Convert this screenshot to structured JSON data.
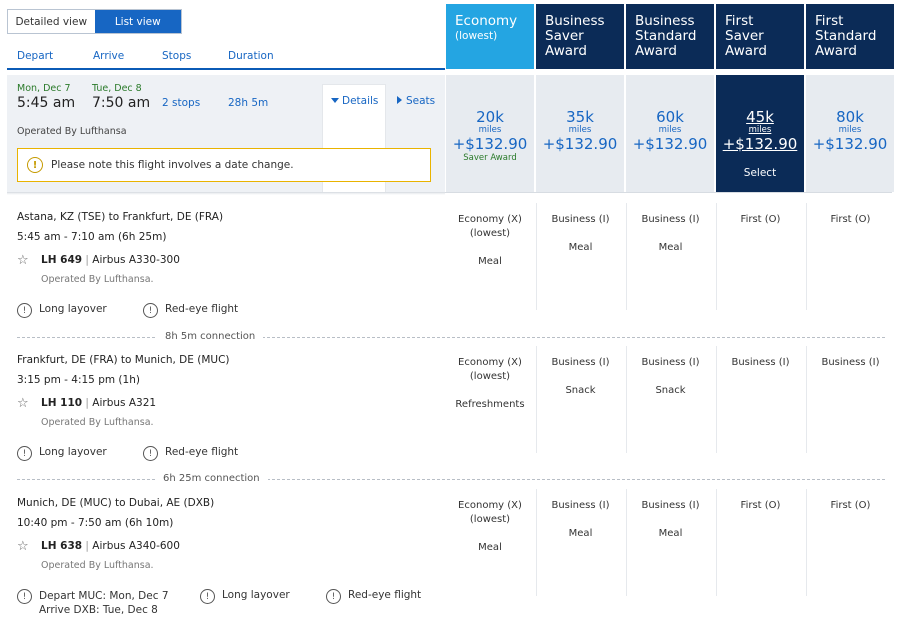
{
  "view_toggle": {
    "detailed": "Detailed view",
    "list": "List view"
  },
  "sort": {
    "depart": "Depart",
    "arrive": "Arrive",
    "stops": "Stops",
    "duration": "Duration"
  },
  "fare_headers": [
    {
      "line1": "Economy",
      "line2": "(lowest)",
      "color": "#24a5e2"
    },
    {
      "line1": "Business",
      "line2": "Saver",
      "line3": "Award",
      "color": "#0b2b57"
    },
    {
      "line1": "Business",
      "line2": "Standard",
      "line3": "Award",
      "color": "#0b2b57"
    },
    {
      "line1": "First Saver",
      "line2": "Award",
      "color": "#0b2b57"
    },
    {
      "line1": "First",
      "line2": "Standard",
      "line3": "Award",
      "color": "#0b2b57"
    }
  ],
  "summary": {
    "depart_date": "Mon, Dec 7",
    "depart_time": "5:45 am",
    "arrive_date": "Tue, Dec 8",
    "arrive_time": "7:50 am",
    "stops": "2 stops",
    "duration": "28h 5m",
    "details": "Details",
    "seats": "Seats",
    "operated": "Operated By Lufthansa",
    "notice": "Please note this flight involves a date change."
  },
  "prices": [
    {
      "miles": "20k",
      "mlabel": "miles",
      "money": "+$132.90",
      "saver": "Saver Award"
    },
    {
      "miles": "35k",
      "mlabel": "miles",
      "money": "+$132.90"
    },
    {
      "miles": "60k",
      "mlabel": "miles",
      "money": "+$132.90"
    },
    {
      "miles": "45k",
      "mlabel": "miles",
      "money": "+$132.90",
      "select": "Select"
    },
    {
      "miles": "80k",
      "mlabel": "miles",
      "money": "+$132.90"
    }
  ],
  "segments": [
    {
      "route": "Astana, KZ (TSE) to Frankfurt, DE (FRA)",
      "time": "5:45 am - 7:10 am (6h 25m)",
      "flight_no": "LH 649",
      "aircraft": "Airbus A330-300",
      "separator": "|",
      "operated": "Operated By Lufthansa.",
      "notes": [
        "Long layover",
        "Red-eye flight"
      ],
      "fares": [
        {
          "cabin": "Economy (X)",
          "extra": "(lowest)",
          "meal": "Meal"
        },
        {
          "cabin": "Business (I)",
          "meal": "Meal"
        },
        {
          "cabin": "Business (I)",
          "meal": "Meal"
        },
        {
          "cabin": "First (O)",
          "meal": ""
        },
        {
          "cabin": "First (O)",
          "meal": ""
        }
      ]
    },
    {
      "route": "Frankfurt, DE (FRA) to Munich, DE (MUC)",
      "time": "3:15 pm - 4:15 pm (1h)",
      "flight_no": "LH 110",
      "aircraft": "Airbus A321",
      "separator": "|",
      "operated": "Operated By Lufthansa.",
      "notes": [
        "Long layover",
        "Red-eye flight"
      ],
      "fares": [
        {
          "cabin": "Economy (X)",
          "extra": "(lowest)",
          "meal": "Refreshments"
        },
        {
          "cabin": "Business (I)",
          "meal": "Snack"
        },
        {
          "cabin": "Business (I)",
          "meal": "Snack"
        },
        {
          "cabin": "Business (I)",
          "meal": ""
        },
        {
          "cabin": "Business (I)",
          "meal": ""
        }
      ]
    },
    {
      "route": "Munich, DE (MUC) to Dubai, AE (DXB)",
      "time": "10:40 pm - 7:50 am (6h 10m)",
      "flight_no": "LH 638",
      "aircraft": "Airbus A340-600",
      "separator": "|",
      "operated": "Operated By Lufthansa.",
      "notes_multi": {
        "line1": "Depart MUC: Mon, Dec 7",
        "line2": "Arrive DXB: Tue, Dec 8"
      },
      "notes": [
        "Long layover",
        "Red-eye flight"
      ],
      "fares": [
        {
          "cabin": "Economy (X)",
          "extra": "(lowest)",
          "meal": "Meal"
        },
        {
          "cabin": "Business (I)",
          "meal": "Meal"
        },
        {
          "cabin": "Business (I)",
          "meal": "Meal"
        },
        {
          "cabin": "First (O)",
          "meal": ""
        },
        {
          "cabin": "First (O)",
          "meal": ""
        }
      ]
    }
  ],
  "connections": [
    "8h 5m connection",
    "6h 25m connection"
  ],
  "icons": {
    "warning": "!",
    "info": "!",
    "star": "☆"
  }
}
